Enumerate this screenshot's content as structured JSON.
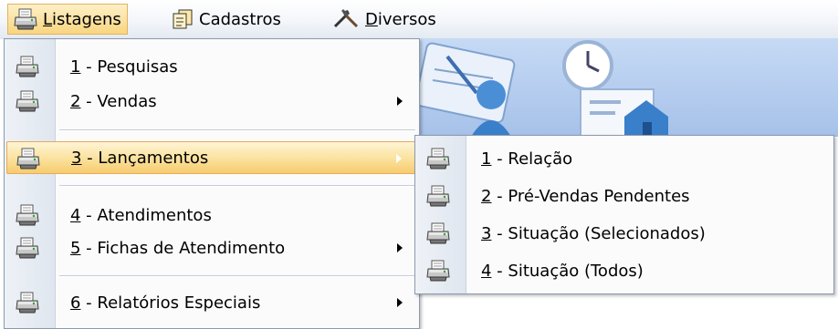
{
  "menubar": {
    "items": [
      {
        "mnemonic": "L",
        "rest": "istagens",
        "icon": "printer-icon"
      },
      {
        "text": "Cadastros",
        "icon": "form-icon"
      },
      {
        "mnemonic": "D",
        "rest": "iversos",
        "icon": "tools-icon"
      }
    ]
  },
  "menu": {
    "items": [
      {
        "mnemonic": "1",
        "rest": " - Pesquisas",
        "submenu": false
      },
      {
        "mnemonic": "2",
        "rest": " - Vendas",
        "submenu": true
      },
      {
        "mnemonic": "3",
        "rest": " - Lançamentos",
        "submenu": true,
        "highlighted": true
      },
      {
        "mnemonic": "4",
        "rest": " - Atendimentos",
        "submenu": false
      },
      {
        "mnemonic": "5",
        "rest": " - Fichas de Atendimento",
        "submenu": true
      },
      {
        "mnemonic": "6",
        "rest": " - Relatórios Especiais",
        "submenu": true
      }
    ]
  },
  "submenu": {
    "items": [
      {
        "mnemonic": "1",
        "rest": " - Relação"
      },
      {
        "mnemonic": "2",
        "rest": " - Pré-Vendas Pendentes"
      },
      {
        "mnemonic": "3",
        "rest": " - Situação (Selecionados)"
      },
      {
        "mnemonic": "4",
        "rest": " - Situação (Todos)"
      }
    ]
  },
  "colors": {
    "highlight": "#f8d680",
    "menu_border": "#8c9aae",
    "background_banner": "#2f79c8"
  }
}
